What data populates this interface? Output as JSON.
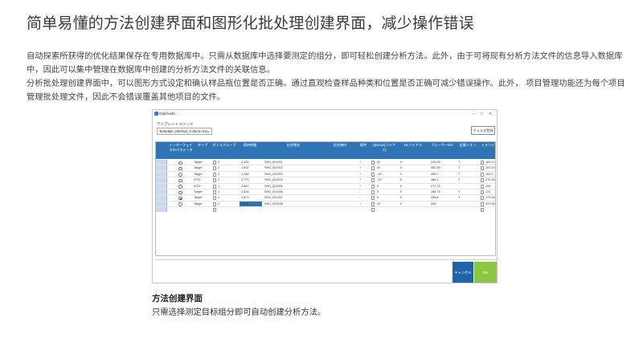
{
  "heading": "简单易懂的方法创建界面和图形化批处理创建界面，减少操作错误",
  "paragraphs": [
    "自动探索所获得的优化结果保存在专用数据库中。只需从数据库中选择要测定的组分，即可轻松创建分析方法。此外，由于可将现有分析方法文件的信息导入数据库中，因此可以集中管理在数据库中创建的分析方法文件的关联信息。",
    "分析批处理创建界面中，可以图形方式设定和确认样品瓶位置是否正确。通过直观检查样品种类和位置是否正确可减少错误操作。此外， 项目管理功能还为每个项目管理批处理文件，因此不会错误覆盖其他项目的文件。"
  ],
  "window": {
    "title": "Optimodb",
    "minimize_icon": "minimize-icon",
    "maximize_icon": "maximize-icon",
    "close_icon": "close-icon",
    "template_label": "テンプレートメソッド",
    "template_value": "Template_Method_Column.lcm",
    "folder_button": "フォルダ登録",
    "columns": [
      "インターフェイスのパラメータ",
      "タイプ",
      "ボトルグループ",
      "保持時間",
      "化合物名",
      "化合物ID",
      "極性",
      "Qminus(パイアス)",
      "DLパイアス",
      "プルーサーmin",
      "定量イオン",
      "トランジ"
    ],
    "rows": [
      {
        "selected": false,
        "type": "Target",
        "group": "2",
        "rt": "0.425",
        "name": "SHD_001001",
        "pol": "+",
        "q": "20",
        "dl": "0",
        "p": "249.05",
        "quant": "T",
        "tr": "184.11"
      },
      {
        "selected": false,
        "type": "Target",
        "group": "2",
        "rt": "1.002",
        "name": "SHD_001002",
        "pol": "+",
        "q": "40",
        "dl": "0",
        "p": "452.30",
        "quant": "T",
        "tr": "203.20"
      },
      {
        "selected": false,
        "type": "Target",
        "group": "2",
        "rt": "2.246",
        "name": "SHD_001003",
        "pol": "+",
        "q": "-10",
        "dl": "0",
        "p": "455.2",
        "quant": "T",
        "tr": "163.1"
      },
      {
        "selected": false,
        "type": "ISTD",
        "group": "2",
        "rt": "2.774",
        "name": "SHD_001004",
        "pol": "+",
        "q": "-10",
        "dl": "0",
        "p": "466.1",
        "quant": "T",
        "tr": "270.25"
      },
      {
        "selected": false,
        "type": "ISTD",
        "group": "1",
        "rt": "2.687",
        "name": "SHD_001005",
        "pol": "+",
        "q": "0",
        "dl": "0",
        "p": "272.75",
        "quant": "",
        "tr": "208"
      },
      {
        "selected": false,
        "type": "Target",
        "group": "1",
        "rt": "2.828",
        "name": "SHD_001006",
        "pol": "-",
        "q": "0",
        "dl": "0",
        "p": "268.75",
        "quant": "T",
        "tr": "131"
      },
      {
        "selected": true,
        "type": "Target",
        "group": "1",
        "rt": "2.871",
        "name": "SHD_001007",
        "pol": "-",
        "q": "0",
        "dl": "0",
        "p": "256.8",
        "quant": "T",
        "tr": "174.25"
      },
      {
        "selected": false,
        "type": "Target",
        "group": "2",
        "rt": "3.624",
        "name": "SHD_001008",
        "pol": "+",
        "q": "20",
        "dl": "0",
        "p": "336",
        "quant": "",
        "tr": "247.05"
      }
    ],
    "cancel_button": "キャンセル",
    "ok_button": "OK"
  },
  "colors": {
    "header_blue": "#2f75b5",
    "cancel_blue": "#1f63a8",
    "ok_green": "#8dc63f"
  },
  "caption": {
    "title": "方法创建界面",
    "text": "只需选择测定目标组分即可自动创建分析方法。"
  }
}
